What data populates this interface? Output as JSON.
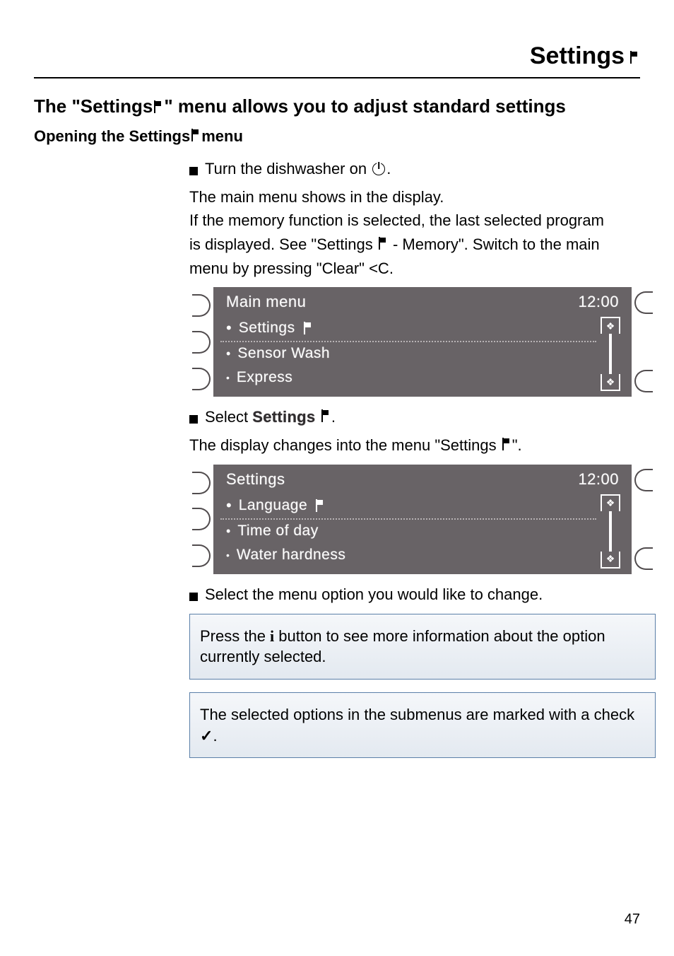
{
  "header": {
    "title": "Settings"
  },
  "heading1": {
    "prefix": "The \"Settings ",
    "suffix": "\" menu allows you to adjust standard settings"
  },
  "heading2": {
    "prefix": "Opening the Settings ",
    "suffix": " menu"
  },
  "body": {
    "step1": "Turn the dishwasher on ",
    "step1_suffix": ".",
    "para1_l1": "The main menu shows in the display.",
    "para1_l2": "If the memory function is selected, the last selected program",
    "para1_l3_a": "is displayed. See \"Settings ",
    "para1_l3_b": " - Memory\". Switch to the main",
    "para1_l4_a": "menu by pressing \"Clear\" ",
    "para1_l4_sym": "<C",
    "para1_l4_b": ".",
    "step2_a": "Select ",
    "step2_b": "Settings ",
    "step2_c": ".",
    "para2_a": "The display changes into the menu \"Settings  ",
    "para2_b": "\".",
    "step3": "Select the menu option you would like to change.",
    "info1_a": "Press the ",
    "info1_i": "i",
    "info1_b": " button to see more information about the option currently selected.",
    "info2_a": "The selected options in the submenus are marked with a check ",
    "info2_chk": "✓",
    "info2_b": "."
  },
  "display1": {
    "title": "Main menu",
    "time": "12:00",
    "items": [
      {
        "label": "Settings ",
        "hasFlag": true
      },
      {
        "label": "Sensor Wash",
        "hasFlag": false
      },
      {
        "label": "Express",
        "hasFlag": false
      }
    ]
  },
  "display2": {
    "title": "Settings",
    "time": "12:00",
    "items": [
      {
        "label": "Language ",
        "hasFlag": true
      },
      {
        "label": "Time of day",
        "hasFlag": false
      },
      {
        "label": "Water hardness",
        "hasFlag": false
      }
    ]
  },
  "pageNumber": "47"
}
